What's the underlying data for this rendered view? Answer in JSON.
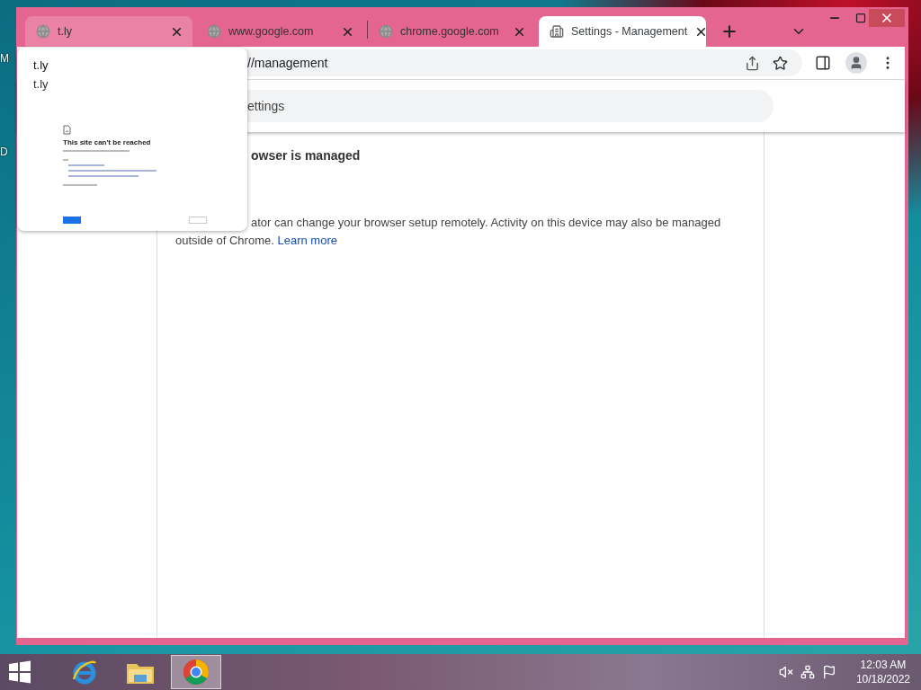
{
  "desktop": {
    "icon_labels": [
      "M",
      "D"
    ]
  },
  "browser": {
    "tabs": [
      {
        "title": "t.ly",
        "kind": "globe",
        "selected": false,
        "hovered": true
      },
      {
        "title": "www.google.com",
        "kind": "globe",
        "selected": false,
        "hovered": false
      },
      {
        "title": "chrome.google.com",
        "kind": "globe",
        "selected": false,
        "hovered": false
      },
      {
        "title": "Settings - Management",
        "kind": "building",
        "selected": true,
        "hovered": false
      }
    ],
    "address": "//management",
    "search_placeholder": "ettings"
  },
  "page": {
    "heading": "owser is managed",
    "paragraph": "ator can change your browser setup remotely. Activity on this device may also be managed outside of Chrome.",
    "link": "Learn more"
  },
  "hover_card": {
    "title": "t.ly",
    "domain": "t.ly",
    "preview_heading": "This site can't be reached"
  },
  "taskbar": {
    "apps": [
      {
        "kind": "ie",
        "selected": false
      },
      {
        "kind": "explorer",
        "selected": false
      },
      {
        "kind": "chrome",
        "selected": true
      }
    ],
    "time": "12:03 AM",
    "date": "10/18/2022"
  }
}
